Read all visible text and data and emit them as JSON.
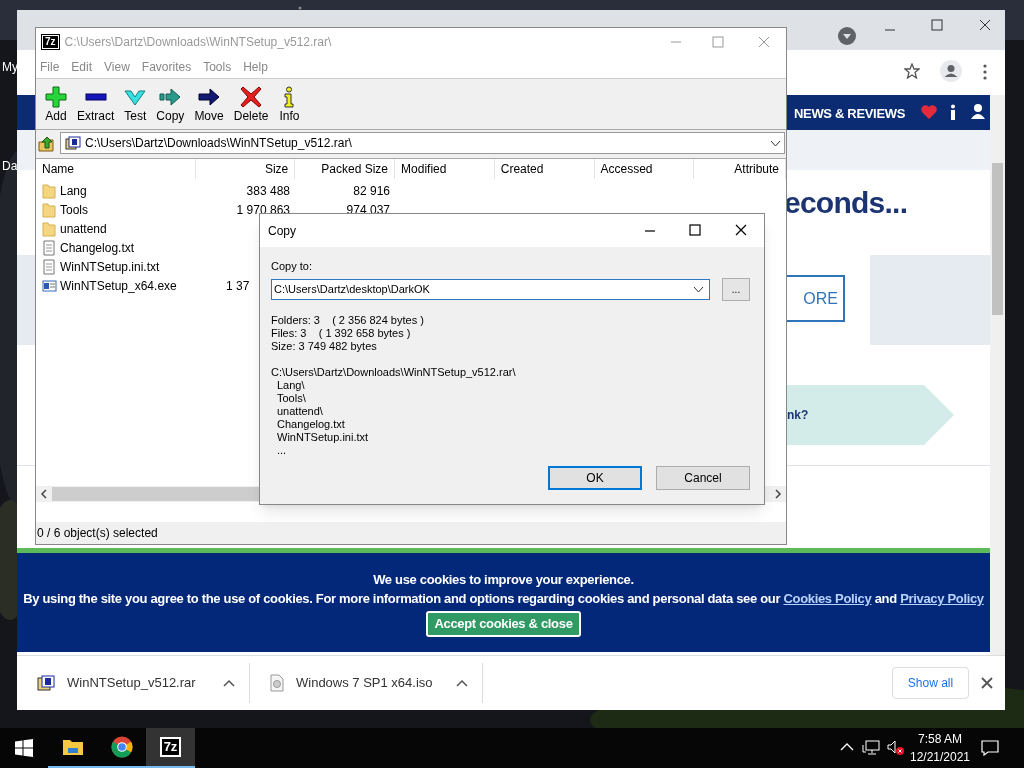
{
  "desktop": {
    "icon_labels": [
      "My",
      "Da"
    ]
  },
  "browser": {
    "site_nav": {
      "label": "NEWS & REVIEWS"
    },
    "headline": "econds...",
    "more_button": "ORE",
    "promo_banner": "nk?",
    "cookie_banner": {
      "title": "We use cookies to improve your experience.",
      "parts": [
        {
          "kind": "text",
          "text": "By using the site you agree to the use of cookies. For more information and options regarding cookies and personal data see our"
        },
        {
          "kind": "link",
          "text": "Cookies Policy"
        },
        {
          "kind": "text",
          "text": "and"
        },
        {
          "kind": "link",
          "text": "Privacy Policy"
        }
      ],
      "button": "Accept cookies & close"
    },
    "downloads": [
      {
        "name": "WinNTSetup_v512.rar",
        "kind": "archive"
      },
      {
        "name": "Windows 7 SP1 x64.iso",
        "kind": "disc"
      }
    ],
    "show_all": "Show all"
  },
  "archiver": {
    "badge": "7z",
    "title": "C:\\Users\\Dartz\\Downloads\\WinNTSetup_v512.rar\\",
    "menu": [
      "File",
      "Edit",
      "View",
      "Favorites",
      "Tools",
      "Help"
    ],
    "toolbar": [
      {
        "label": "Add",
        "kind": "add"
      },
      {
        "label": "Extract",
        "kind": "extract"
      },
      {
        "label": "Test",
        "kind": "test"
      },
      {
        "label": "Copy",
        "kind": "copy"
      },
      {
        "label": "Move",
        "kind": "move"
      },
      {
        "label": "Delete",
        "kind": "delete"
      },
      {
        "label": "Info",
        "kind": "info"
      }
    ],
    "address": "C:\\Users\\Dartz\\Downloads\\WinNTSetup_v512.rar\\",
    "columns": [
      "Name",
      "Size",
      "Packed Size",
      "Modified",
      "Created",
      "Accessed",
      "Attribute"
    ],
    "rows": [
      {
        "name": "Lang",
        "kind": "folder",
        "size": "383 488",
        "packed_size": "82 916"
      },
      {
        "name": "Tools",
        "kind": "folder",
        "size": "1 970 863",
        "packed_size": "974 037"
      },
      {
        "name": "unattend",
        "kind": "folder"
      },
      {
        "name": "Changelog.txt",
        "kind": "text"
      },
      {
        "name": "WinNTSetup.ini.txt",
        "kind": "text"
      },
      {
        "name": "WinNTSetup_x64.exe",
        "kind": "program",
        "size": "1 37",
        "size_cut": true
      }
    ],
    "status": "0 / 6 object(s) selected"
  },
  "copy_dialog": {
    "title": "Copy",
    "label": "Copy to:",
    "value": "C:\\Users\\Dartz\\desktop\\DarkOK",
    "browse": "...",
    "summary": [
      "Folders: 3    ( 2 356 824 bytes )",
      "Files: 3    ( 1 392 658 bytes )",
      "Size: 3 749 482 bytes"
    ],
    "items": [
      "C:\\Users\\Dartz\\Downloads\\WinNTSetup_v512.rar\\",
      "Lang\\",
      "Tools\\",
      "unattend\\",
      "Changelog.txt",
      "WinNTSetup.ini.txt",
      "..."
    ],
    "buttons": [
      {
        "label": "OK",
        "selected": true
      },
      {
        "label": "Cancel",
        "selected": false
      }
    ]
  },
  "taskbar": {
    "apps": [
      {
        "kind": "explorer",
        "active": false
      },
      {
        "kind": "chrome",
        "active": false
      },
      {
        "kind": "archiver",
        "label": "7z",
        "active": true
      }
    ],
    "time": "7:58 AM",
    "date": "12/21/2021"
  }
}
